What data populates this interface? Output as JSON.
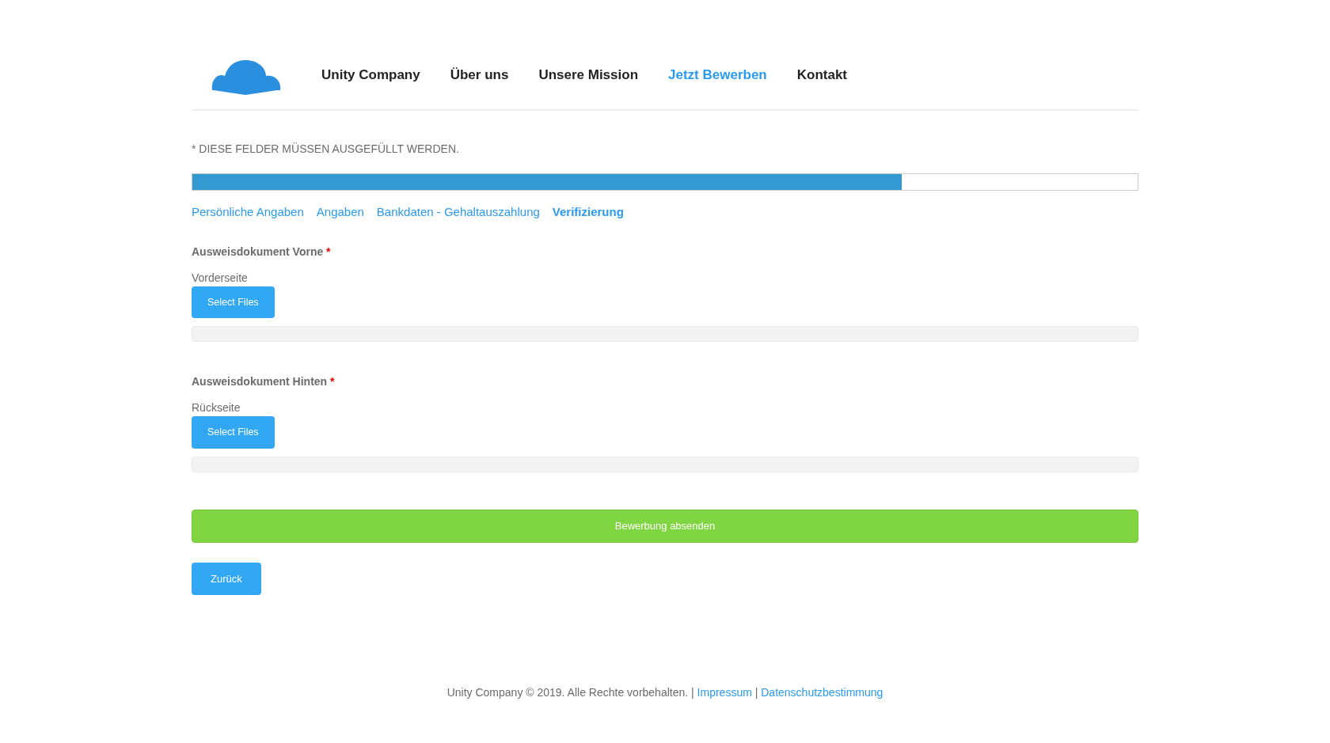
{
  "nav": [
    {
      "label": "Unity Company",
      "selected": false
    },
    {
      "label": "Über uns",
      "selected": false
    },
    {
      "label": "Unsere Mission",
      "selected": false
    },
    {
      "label": "Jetzt Bewerben",
      "selected": true
    },
    {
      "label": "Kontakt",
      "selected": false
    }
  ],
  "required_note": "* DIESE FELDER MÜSSEN AUSGEFÜLLT WERDEN.",
  "progress": {
    "level": 0.75
  },
  "steps": [
    {
      "label": "Persönliche Angaben",
      "selected": false
    },
    {
      "label": "Angaben",
      "selected": false
    },
    {
      "label": "Bankdaten - Gehaltauszahlung",
      "selected": false
    },
    {
      "label": "Verifizierung",
      "selected": true
    }
  ],
  "uploads": [
    {
      "title": "Ausweisdokument Vorne",
      "required_mark": "*",
      "label": "Vorderseite",
      "button": "Select Files"
    },
    {
      "title": "Ausweisdokument Hinten",
      "required_mark": "*",
      "label": "Rückseite",
      "button": "Select Files"
    }
  ],
  "submit_button": "Bewerbung absenden",
  "back_button": "Zurück",
  "footer": {
    "copyright": "Unity Company © 2019. Alle Rechte vorbehalten.",
    "separator_1": "|",
    "link_1": "Impressum",
    "separator_2": "|",
    "link_2": "Datenschutzbestimmung"
  }
}
